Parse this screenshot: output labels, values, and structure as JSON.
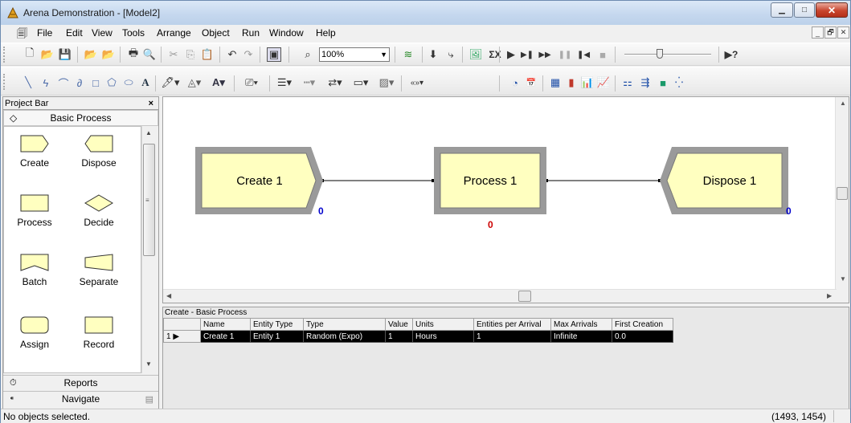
{
  "window": {
    "title": "Arena Demonstration - [Model2]",
    "min_glyph": "▁",
    "max_glyph": "□",
    "close_glyph": "✕"
  },
  "menu": {
    "items": [
      "File",
      "Edit",
      "View",
      "Tools",
      "Arrange",
      "Object",
      "Run",
      "Window",
      "Help"
    ],
    "mdi": [
      "_",
      "🗗",
      "✕"
    ]
  },
  "toolbar1": {
    "zoom_value": "100%",
    "help_glyph": "▶?"
  },
  "project_bar": {
    "title": "Project Bar",
    "close": "×",
    "panel": "Basic Process",
    "modules": [
      "Create",
      "Dispose",
      "Process",
      "Decide",
      "Batch",
      "Separate",
      "Assign",
      "Record"
    ],
    "reports": "Reports",
    "navigate": "Navigate"
  },
  "canvas": {
    "modules": [
      {
        "label": "Create 1",
        "counter": "0",
        "counter_color": "#0000cc"
      },
      {
        "label": "Process 1",
        "counter": "0",
        "counter_color": "#cc0000"
      },
      {
        "label": "Dispose 1",
        "counter": "0",
        "counter_color": "#0000cc"
      }
    ],
    "shape_fill": "#ffffc0",
    "shape_border": "#9a9a9a"
  },
  "spreadsheet": {
    "title": "Create - Basic Process",
    "columns": [
      "Name",
      "Entity Type",
      "Type",
      "Value",
      "Units",
      "Entities per Arrival",
      "Max Arrivals",
      "First Creation"
    ],
    "row_number": "1",
    "row": [
      "Create 1",
      "Entity 1",
      "Random (Expo)",
      "1",
      "Hours",
      "1",
      "Infinite",
      "0.0"
    ]
  },
  "status": {
    "message": "No objects selected.",
    "coords": "(1493, 1454)"
  }
}
